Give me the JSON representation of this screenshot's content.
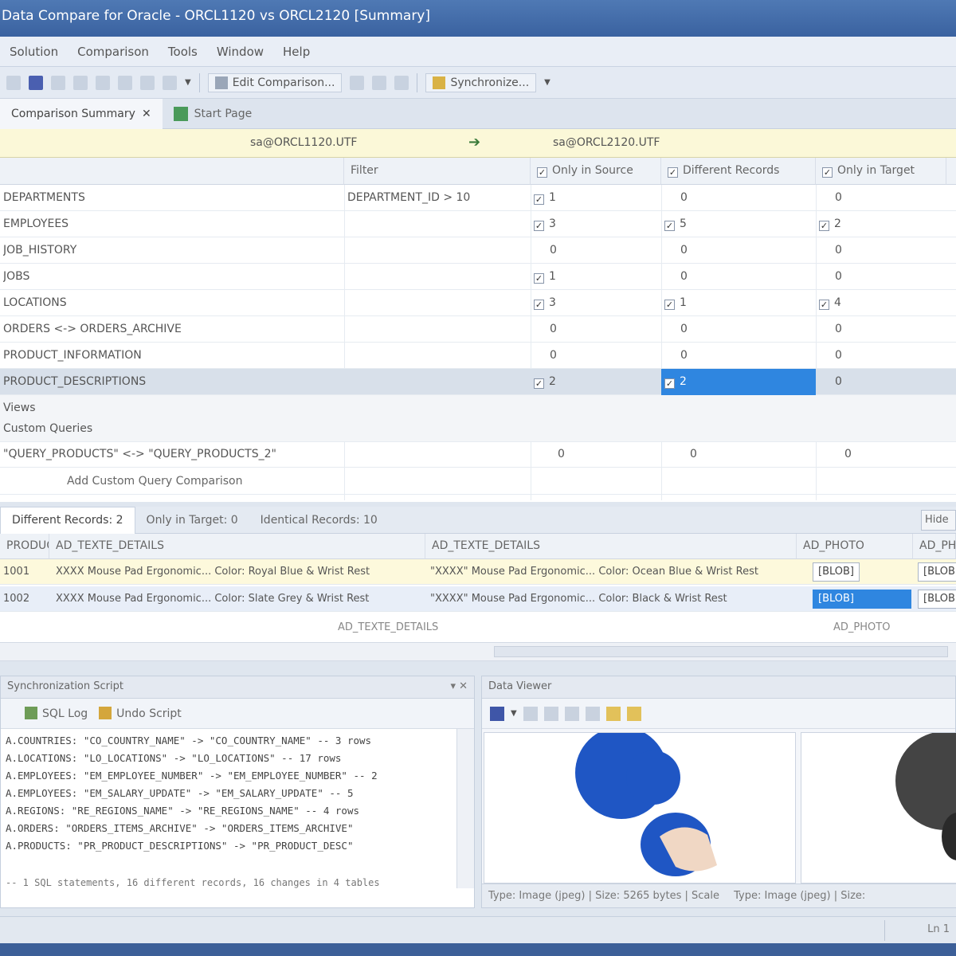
{
  "window": {
    "title": "Data Compare for Oracle - ORCL1120 vs ORCL2120 [Summary]"
  },
  "menu": [
    "Solution",
    "Comparison",
    "Tools",
    "Window",
    "Help"
  ],
  "toolbar": {
    "edit_label": "Edit Comparison...",
    "sync_label": "Synchronize..."
  },
  "doctabs": [
    {
      "label": "Comparison Summary",
      "active": true
    },
    {
      "label": "Start Page",
      "active": false
    }
  ],
  "compare": {
    "source": "sa@ORCL1120.UTF",
    "target": "sa@ORCL2120.UTF"
  },
  "grid": {
    "headers": [
      "",
      "Filter",
      "Only in Source",
      "Different Records",
      "Only in Target"
    ],
    "rows": [
      {
        "name": "DEPARTMENTS",
        "filter": "DEPARTMENT_ID > 10",
        "a": "1",
        "b": "0",
        "c": "0",
        "ca": true,
        "cb": false,
        "cc": false
      },
      {
        "name": "EMPLOYEES",
        "filter": "",
        "a": "3",
        "b": "5",
        "c": "2",
        "ca": true,
        "cb": true,
        "cc": true
      },
      {
        "name": "JOB_HISTORY",
        "filter": "",
        "a": "0",
        "b": "0",
        "c": "0",
        "ca": false,
        "cb": false,
        "cc": false
      },
      {
        "name": "JOBS",
        "filter": "",
        "a": "1",
        "b": "0",
        "c": "0",
        "ca": true,
        "cb": false,
        "cc": false
      },
      {
        "name": "LOCATIONS",
        "filter": "",
        "a": "3",
        "b": "1",
        "c": "4",
        "ca": true,
        "cb": true,
        "cc": true
      },
      {
        "name": "ORDERS <-> ORDERS_ARCHIVE",
        "filter": "",
        "a": "0",
        "b": "0",
        "c": "0",
        "ca": false,
        "cb": false,
        "cc": false
      },
      {
        "name": "PRODUCT_INFORMATION",
        "filter": "",
        "a": "0",
        "b": "0",
        "c": "0",
        "ca": false,
        "cb": false,
        "cc": false
      },
      {
        "name": "PRODUCT_DESCRIPTIONS",
        "filter": "",
        "a": "2",
        "b": "2",
        "c": "0",
        "ca": true,
        "cb": true,
        "cc": false,
        "selected": true
      }
    ],
    "group1": "Views",
    "group2": "Custom Queries",
    "query_row": {
      "name": "\"QUERY_PRODUCTS\" <-> \"QUERY_PRODUCTS_2\"",
      "a": "0",
      "b": "0",
      "c": "0"
    },
    "query_hint": "Add Custom Query Comparison"
  },
  "results": {
    "tabs": [
      "Different Records: 2",
      "Only in Target: 0",
      "Identical Records: 10"
    ],
    "hide_label": "Hide",
    "headers": [
      "PRODUCT_ID",
      "AD_TEXTE_DETAILS",
      "AD_TEXTE_DETAILS",
      "AD_PHOTO",
      "AD_PHOTO"
    ],
    "rows": [
      {
        "id": "1001",
        "src": "XXXX Mouse Pad Ergonomic... Color: Royal Blue & Wrist Rest",
        "tgt": "\"XXXX\" Mouse Pad Ergonomic... Color: Ocean Blue & Wrist Rest",
        "p1": "[BLOB]",
        "p2": "[BLOB]"
      },
      {
        "id": "1002",
        "src": "XXXX Mouse Pad Ergonomic... Color: Slate Grey & Wrist Rest",
        "tgt": "\"XXXX\" Mouse Pad Ergonomic... Color: Black & Wrist Rest",
        "p1": "[BLOB]",
        "p2": "[BLOB]"
      }
    ],
    "footer_left": "AD_TEXTE_DETAILS",
    "footer_right": "AD_PHOTO"
  },
  "script": {
    "title": "Synchronization Script",
    "ctrls": "▾ ✕",
    "tools": [
      "SQL Log",
      "Undo Script"
    ],
    "lines": [
      "A.COUNTRIES: \"CO_COUNTRY_NAME\" -> \"CO_COUNTRY_NAME\" -- 3 rows",
      "A.LOCATIONS: \"LO_LOCATIONS\" -> \"LO_LOCATIONS\" -- 17 rows",
      "A.EMPLOYEES: \"EM_EMPLOYEE_NUMBER\" -> \"EM_EMPLOYEE_NUMBER\" -- 2",
      "A.EMPLOYEES: \"EM_SALARY_UPDATE\" -> \"EM_SALARY_UPDATE\" -- 5",
      "A.REGIONS: \"RE_REGIONS_NAME\" -> \"RE_REGIONS_NAME\" -- 4 rows",
      "A.ORDERS: \"ORDERS_ITEMS_ARCHIVE\" -> \"ORDERS_ITEMS_ARCHIVE\"",
      "A.PRODUCTS: \"PR_PRODUCT_DESCRIPTIONS\" -> \"PR_PRODUCT_DESC\""
    ],
    "footer": "-- 1 SQL statements, 16 different records, 16 changes in 4 tables"
  },
  "viewer": {
    "title": "Data Viewer",
    "left_status": "Type: Image (jpeg) | Size: 5265 bytes | Scale",
    "right_status": "Type: Image (jpeg) | Size:"
  },
  "status": {
    "right": "Ln 1"
  }
}
